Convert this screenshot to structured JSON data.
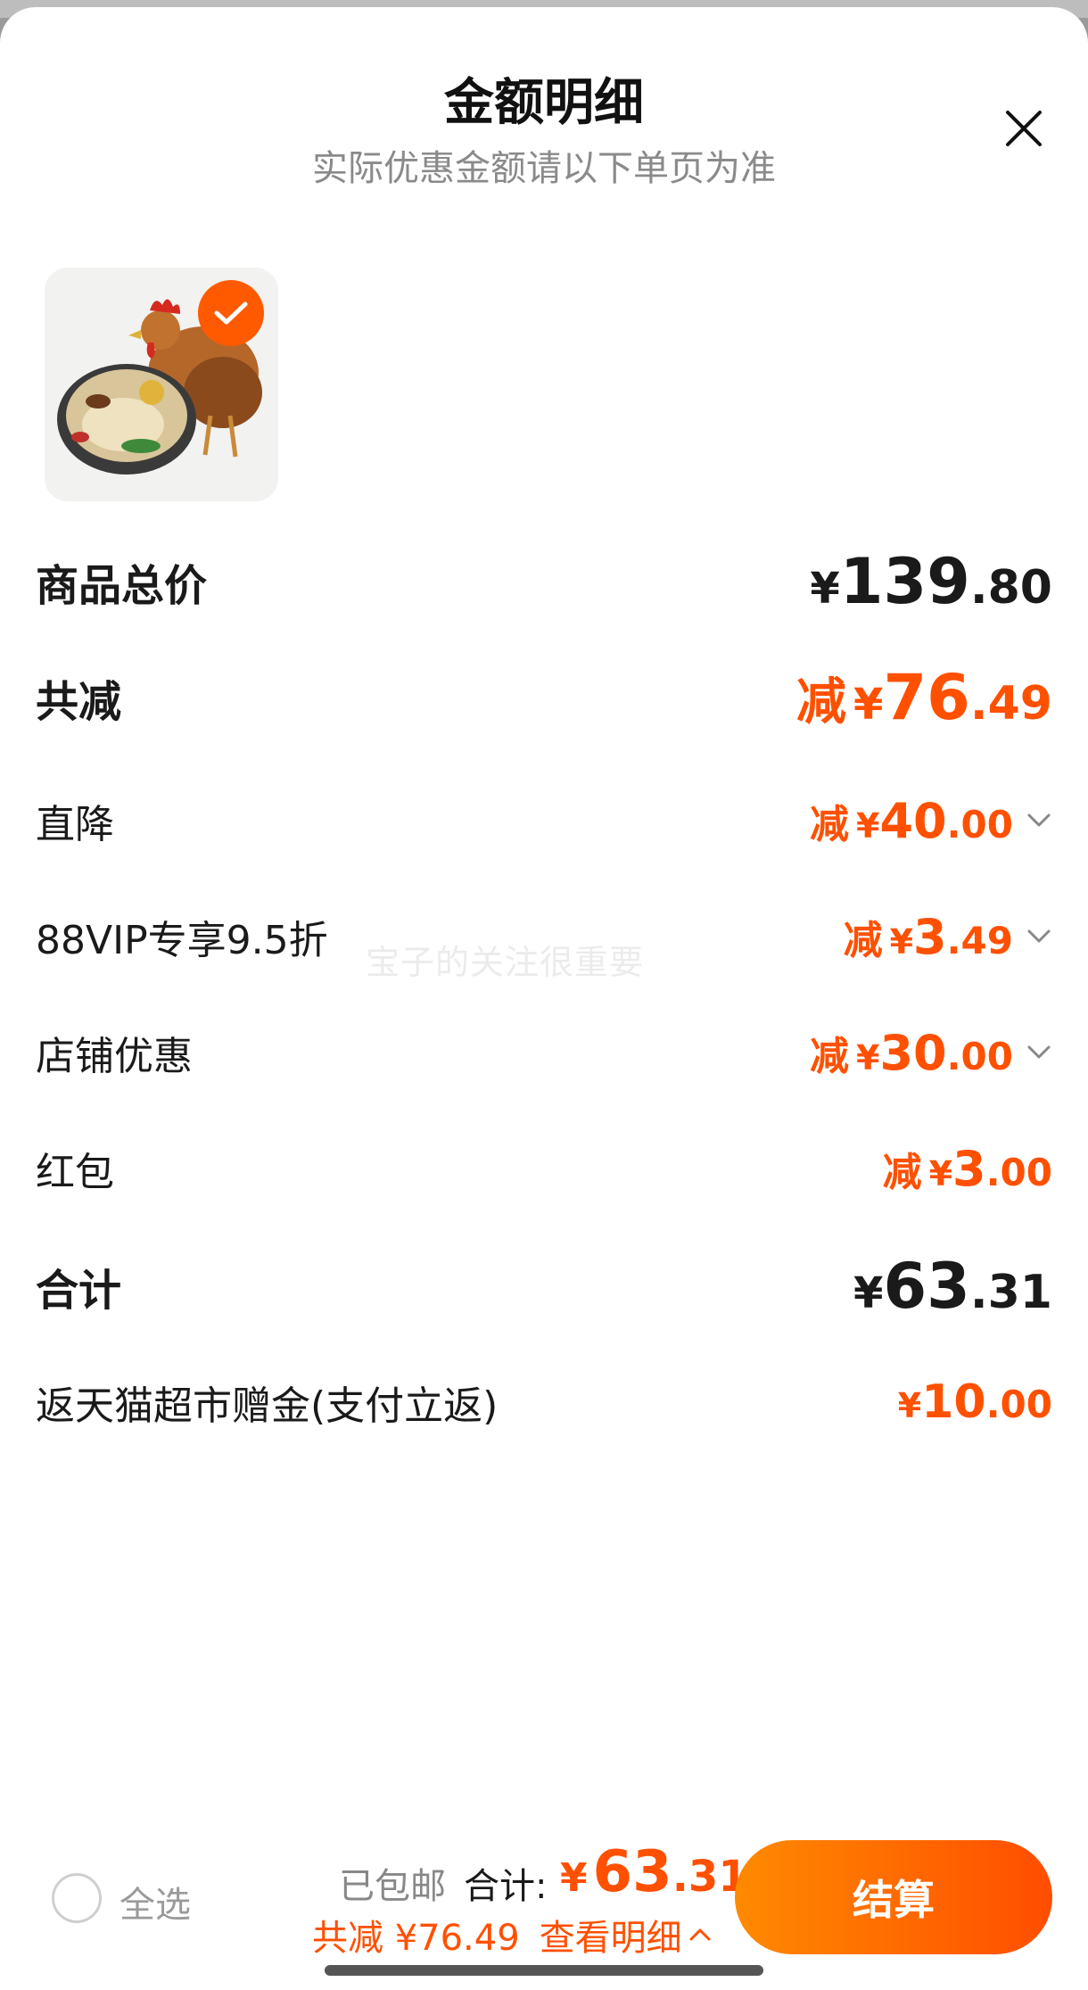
{
  "sheet": {
    "title": "金额明细",
    "subtitle": "实际优惠金额请以下单页为准",
    "watermark": "宝子的关注很重要"
  },
  "rows": {
    "subtotal": {
      "label": "商品总价",
      "cur": "¥",
      "int": "139",
      "dec": ".80"
    },
    "total_reduce": {
      "label": "共减",
      "prefix": "减",
      "cur": "¥",
      "int": "76",
      "dec": ".49"
    },
    "direct": {
      "label": "直降",
      "prefix": "减",
      "cur": "¥",
      "int": "40",
      "dec": ".00"
    },
    "vip": {
      "label": "88VIP专享9.5折",
      "prefix": "减",
      "cur": "¥",
      "int": "3",
      "dec": ".49"
    },
    "shop": {
      "label": "店铺优惠",
      "prefix": "减",
      "cur": "¥",
      "int": "30",
      "dec": ".00"
    },
    "redpacket": {
      "label": "红包",
      "prefix": "减",
      "cur": "¥",
      "int": "3",
      "dec": ".00"
    },
    "sum": {
      "label": "合计",
      "cur": "¥",
      "int": "63",
      "dec": ".31"
    },
    "rebate": {
      "label": "返天猫超市赠金(支付立返)",
      "cur": "¥",
      "int": "10",
      "dec": ".00"
    }
  },
  "bottom": {
    "select_all": "全选",
    "shipping": "已包邮",
    "total_label": "合计:",
    "total_cur": "¥",
    "total_int": "63",
    "total_dec": ".31",
    "reduce_text": "共减 ¥76.49",
    "detail_link": "查看明细",
    "checkout": "结算"
  },
  "colors": {
    "accent": "#ff5000",
    "checkout_start": "#ff8a00",
    "checkout_end": "#ff4d00"
  },
  "icons": {
    "close": "close-icon",
    "check": "check-icon",
    "chevron": "chevron-down-icon",
    "chevron_up": "chevron-up-icon"
  }
}
